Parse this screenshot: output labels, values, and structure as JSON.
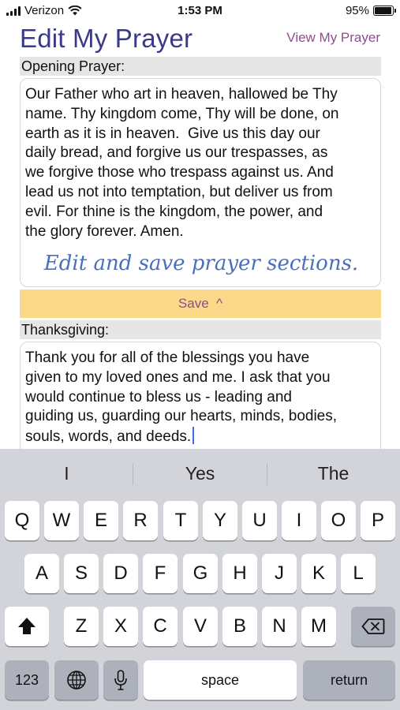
{
  "status_bar": {
    "carrier": "Verizon",
    "time": "1:53 PM",
    "battery": "95%",
    "battery_level": 0.95
  },
  "header": {
    "title": "Edit My Prayer",
    "view_link": "View My Prayer"
  },
  "opening": {
    "label": "Opening Prayer:",
    "lines": [
      "Our Father who art in heaven, hallowed be Thy",
      "name. Thy kingdom come, Thy will be done, on",
      "earth as it is in heaven.  Give us this day our",
      "daily bread, and forgive us our trespasses, as",
      "we forgive those who trespass against us. And",
      "lead us not into temptation, but deliver us from",
      "evil. For thine is the kingdom, the power, and",
      "the glory forever. Amen."
    ],
    "hint": "Edit and save prayer sections."
  },
  "save_button": "Save  ^",
  "thanksgiving": {
    "label": "Thanksgiving:",
    "lines": [
      "Thank you for all of the blessings you have",
      "given to my loved ones and me. I ask that you",
      "would continue to bless us - leading and",
      "guiding us, guarding our hearts, minds, bodies,",
      "souls, words, and deeds."
    ]
  },
  "keyboard": {
    "suggestions": [
      "I",
      "Yes",
      "The"
    ],
    "row1": [
      "Q",
      "W",
      "E",
      "R",
      "T",
      "Y",
      "U",
      "I",
      "O",
      "P"
    ],
    "row2": [
      "A",
      "S",
      "D",
      "F",
      "G",
      "H",
      "J",
      "K",
      "L"
    ],
    "row3": [
      "Z",
      "X",
      "C",
      "V",
      "B",
      "N",
      "M"
    ],
    "numbers_key": "123",
    "space_key": "space",
    "return_key": "return"
  },
  "colors": {
    "title": "#3b3a8a",
    "link": "#8a4f8c",
    "save_bar": "#fad98a",
    "hint": "#4a6fc0",
    "keyboard_bg": "#d2d4d9"
  },
  "icons": [
    "signal-icon",
    "wifi-icon",
    "battery-icon",
    "shift-icon",
    "delete-icon",
    "globe-icon",
    "microphone-icon"
  ]
}
